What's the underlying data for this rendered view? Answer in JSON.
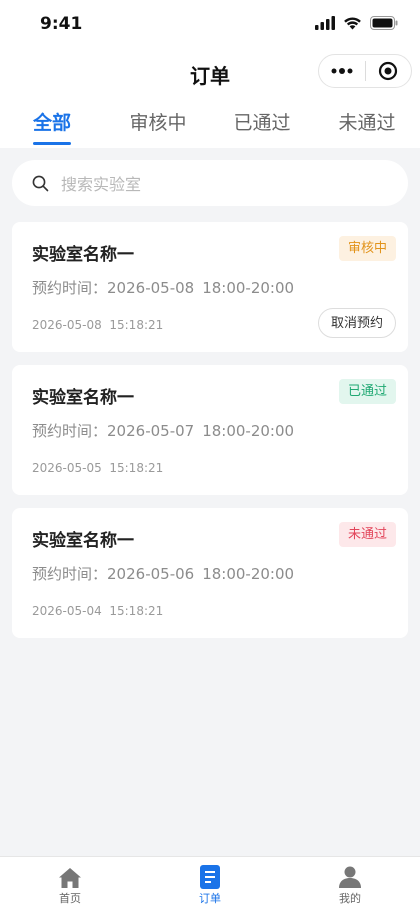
{
  "status_bar": {
    "time": "9:41"
  },
  "nav": {
    "title": "订单"
  },
  "tabs": [
    {
      "label": "全部"
    },
    {
      "label": "审核中"
    },
    {
      "label": "已通过"
    },
    {
      "label": "未通过"
    }
  ],
  "search": {
    "placeholder": "搜索实验室"
  },
  "orders": [
    {
      "lab_name": "实验室名称一",
      "status": "审核中",
      "reserve_label": "预约时间：",
      "reserve_date": "2026-05-08",
      "reserve_range": "18:00-20:00",
      "created": "2026-05-08  15:18:21",
      "action": "取消预约"
    },
    {
      "lab_name": "实验室名称一",
      "status": "已通过",
      "reserve_label": "预约时间：",
      "reserve_date": "2026-05-07",
      "reserve_range": "18:00-20:00",
      "created": "2026-05-05  15:18:21"
    },
    {
      "lab_name": "实验室名称一",
      "status": "未通过",
      "reserve_label": "预约时间：",
      "reserve_date": "2026-05-06",
      "reserve_range": "18:00-20:00",
      "created": "2026-05-04  15:18:21"
    }
  ],
  "tabbar": [
    {
      "label": "首页",
      "icon": "home-icon"
    },
    {
      "label": "订单",
      "icon": "order-icon"
    },
    {
      "label": "我的",
      "icon": "user-icon"
    }
  ],
  "colors": {
    "accent": "#1a73e8",
    "pending": "#e2931a",
    "passed": "#1fa872",
    "failed": "#e2455a"
  }
}
